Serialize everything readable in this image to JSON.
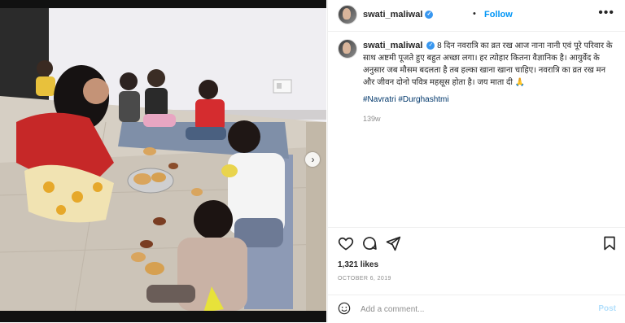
{
  "post": {
    "username": "swati_maliwal",
    "verified_icon": "verified-badge-icon",
    "separator": "•",
    "follow_label": "Follow",
    "more_icon": "more-options-icon",
    "caption_text": "8 दिन नवरात्रि का व्रत रख आज नाना नानी एवं पूरे परिवार के साथ अष्टमी पूजते हुए बहुत अच्छा लगा। हर त्योहार कितना वैज्ञानिक है। आयुर्वेद के अनुसार जब मौसम बदलता है तब हल्का खाना खाना चाहिए। नवरात्रि का व्रत रख मन और जीवन दोनो पवित्र महसूस होता है। जय माता दी 🙏",
    "hashtags": "#Navratri #Durghashtmi",
    "caption_meta": "139w",
    "likes": "1,321 likes",
    "date": "OCTOBER 6, 2019",
    "comment_placeholder": "Add a comment...",
    "post_label": "Post"
  },
  "media": {
    "description_icon": "photo",
    "next_icon": "chevron-right-icon"
  },
  "actions": {
    "like_icon": "heart-icon",
    "comment_icon": "comment-icon",
    "share_icon": "send-icon",
    "save_icon": "bookmark-icon"
  },
  "colors": {
    "link_blue": "#0095f6",
    "hashtag": "#00376b",
    "muted": "#8e8e8e",
    "post_disabled": "#b2dffc"
  }
}
